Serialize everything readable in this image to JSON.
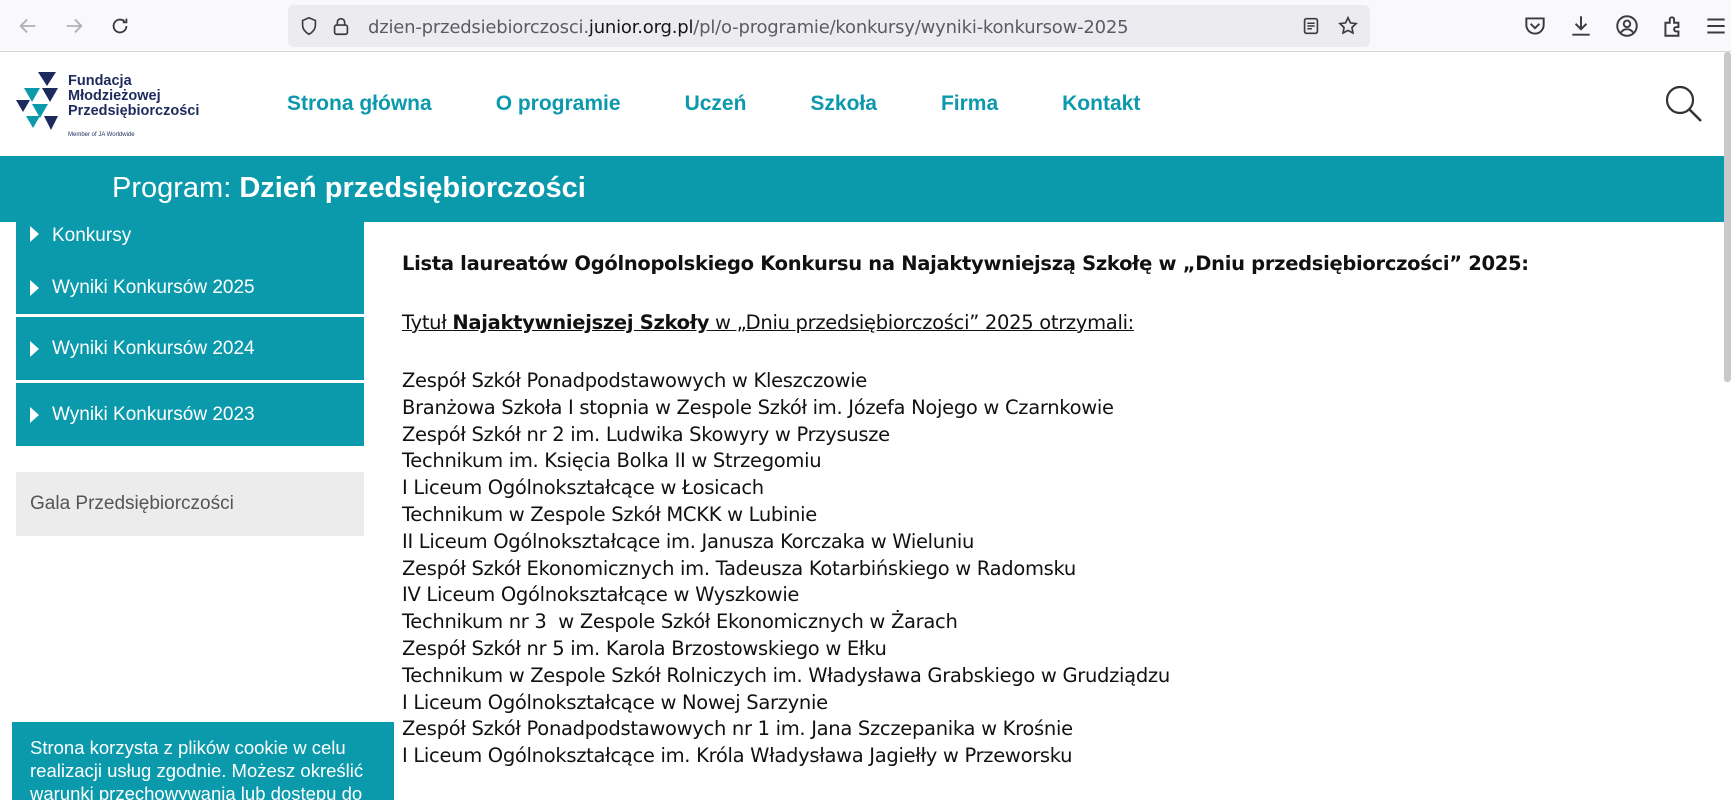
{
  "browser": {
    "url_prefix": "dzien-przedsiebiorczosci.",
    "url_domain": "junior.org.pl",
    "url_path": "/pl/o-programie/konkursy/wyniki-konkursow-2025"
  },
  "logo": {
    "line1": "Fundacja",
    "line2": "Młodzieżowej",
    "line3": "Przedsiębiorczości",
    "tagline": "Member of JA Worldwide"
  },
  "nav": {
    "items": [
      "Strona główna",
      "O programie",
      "Uczeń",
      "Szkoła",
      "Firma",
      "Kontakt"
    ]
  },
  "banner": {
    "prefix": "Program: ",
    "title": "Dzień przedsiębiorczości"
  },
  "sidebar": {
    "items": [
      {
        "label": "Konkursy"
      },
      {
        "label": "Wyniki Konkursów 2025"
      },
      {
        "label": "Wyniki Konkursów 2024"
      },
      {
        "label": "Wyniki Konkursów 2023"
      },
      {
        "label": "Gala Przedsiębiorczości"
      }
    ]
  },
  "content": {
    "heading": "Lista laureatów Ogólnopolskiego Konkursu na Najaktywniejszą Szkołę w „Dniu przedsiębiorczości” 2025:",
    "subtitle_pre": "Tytuł ",
    "subtitle_bold": "Najaktywniejszej Szkoły",
    "subtitle_post": " w „Dniu przedsiębiorczości” 2025 otrzymali:",
    "schools": [
      "Zespół Szkół Ponadpodstawowych w Kleszczowie",
      "Branżowa Szkoła I stopnia w Zespole Szkół im. Józefa Nojego w Czarnkowie",
      "Zespół Szkół nr 2 im. Ludwika Skowyry w Przysusze",
      "Technikum im. Księcia Bolka II w Strzegomiu",
      "I Liceum Ogólnokształcące w Łosicach",
      "Technikum w Zespole Szkół MCKK w Lubinie",
      "II Liceum Ogólnokształcące im. Janusza Korczaka w Wieluniu",
      "Zespół Szkół Ekonomicznych im. Tadeusza Kotarbińskiego w Radomsku",
      "IV Liceum Ogólnokształcące w Wyszkowie",
      "Technikum nr 3  w Zespole Szkół Ekonomicznych w Żarach",
      "Zespół Szkół nr 5 im. Karola Brzostowskiego w Ełku",
      "Technikum w Zespole Szkół Rolniczych im. Władysława Grabskiego w Grudziądzu",
      "I Liceum Ogólnokształcące w Nowej Sarzynie",
      "Zespół Szkół Ponadpodstawowych nr 1 im. Jana Szczepanika w Krośnie",
      "I Liceum Ogólnokształcące im. Króla Władysława Jagiełły w Przeworsku"
    ]
  },
  "cookie": {
    "line1": "Strona korzysta z plików cookie w celu",
    "line2": "realizacji usług zgodnie. Możesz określić",
    "line3": "warunki przechowywania lub dostępu do"
  },
  "colors": {
    "accent": "#0a9aac",
    "nav_text": "#0c98ad",
    "logo_dark": "#1d2b5c"
  }
}
